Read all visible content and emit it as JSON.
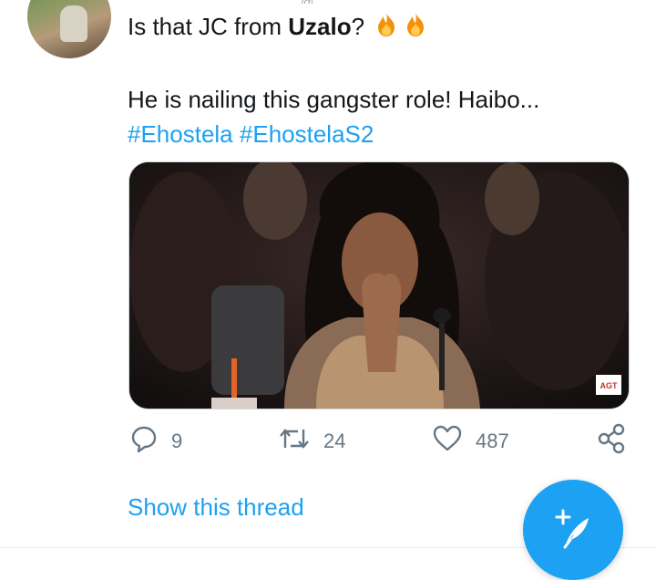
{
  "tweet": {
    "text_prefix": "Is that JC from ",
    "text_bold": "Uzalo",
    "text_suffix": "?",
    "line2": "He is nailing this gangster role! Haibo...",
    "hashtags": [
      "#Ehostela",
      "#EhostelaS2"
    ],
    "handle_fragment": "@"
  },
  "media": {
    "watermark": "AGT"
  },
  "actions": {
    "replies": "9",
    "retweets": "24",
    "likes": "487"
  },
  "thread": {
    "show_label": "Show this thread"
  },
  "colors": {
    "accent": "#1da1f2",
    "icon_gray": "#657786",
    "text": "#14171a"
  },
  "icons": [
    "reply-icon",
    "retweet-icon",
    "like-icon",
    "share-icon",
    "compose-tweet-icon",
    "fire-emoji-icon"
  ]
}
